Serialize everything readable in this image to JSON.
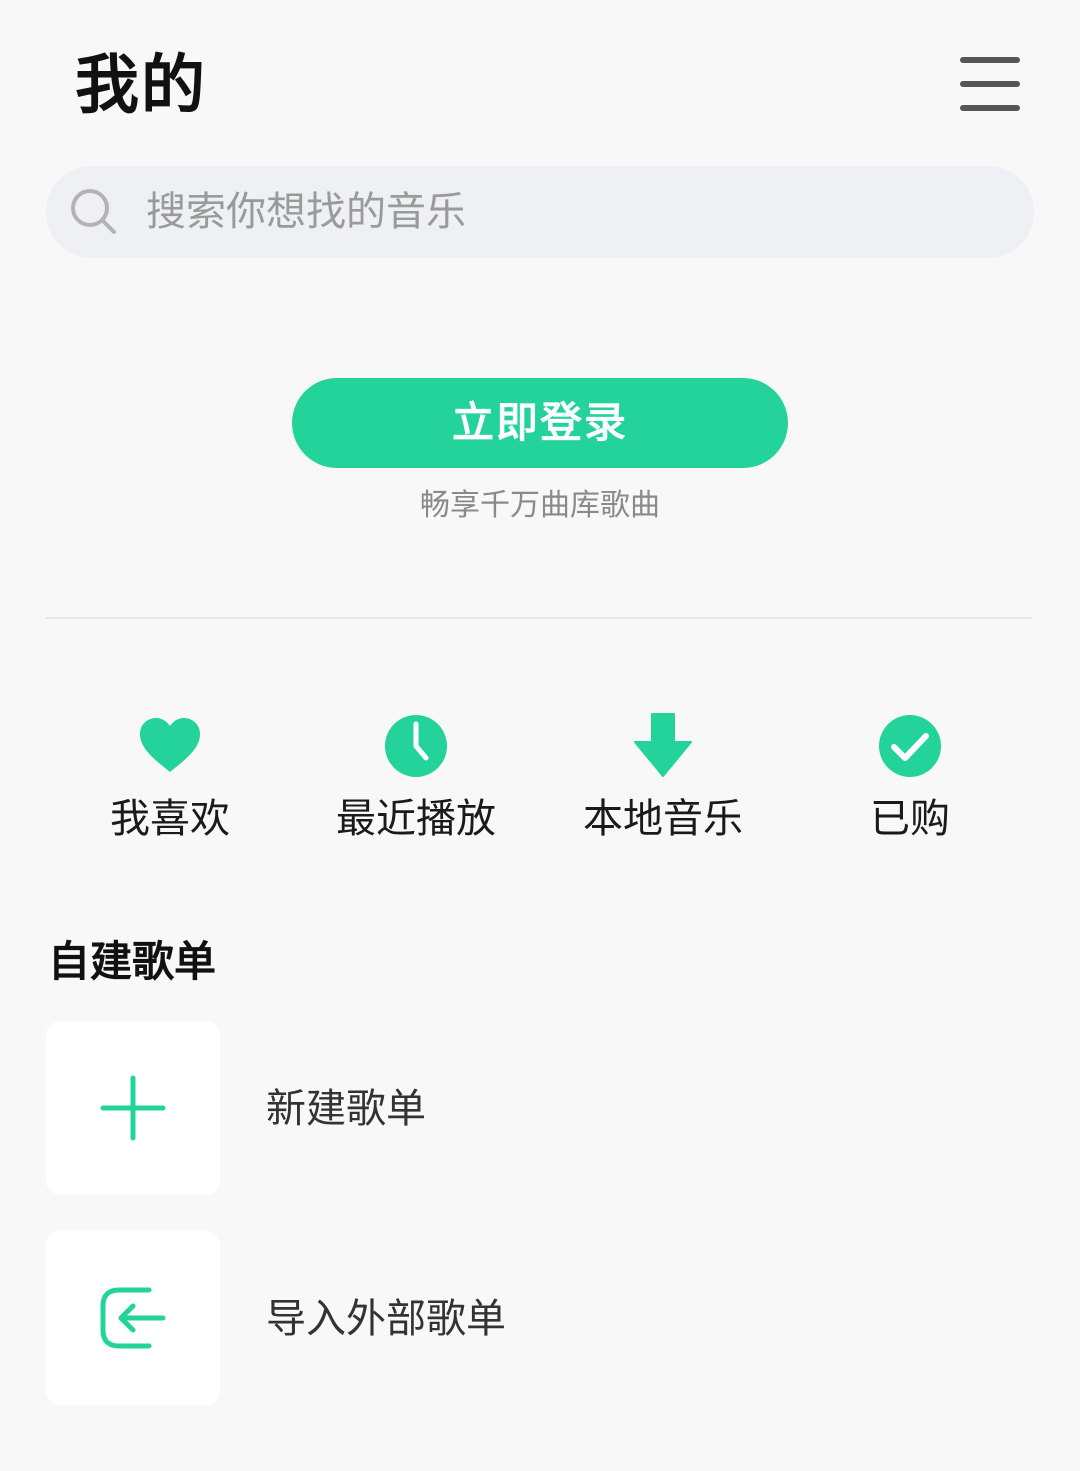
{
  "header": {
    "title": "我的",
    "menu_icon": "hamburger-menu-icon"
  },
  "search": {
    "placeholder": "搜索你想找的音乐",
    "icon": "search-icon"
  },
  "login": {
    "button_label": "立即登录",
    "subtitle": "畅享千万曲库歌曲"
  },
  "quick_actions": [
    {
      "label": "我喜欢",
      "icon": "heart-icon"
    },
    {
      "label": "最近播放",
      "icon": "clock-icon"
    },
    {
      "label": "本地音乐",
      "icon": "download-arrow-icon"
    },
    {
      "label": "已购",
      "icon": "check-circle-icon"
    }
  ],
  "playlists": {
    "section_title": "自建歌单",
    "items": [
      {
        "label": "新建歌单",
        "icon": "plus-icon"
      },
      {
        "label": "导入外部歌单",
        "icon": "import-icon"
      }
    ]
  },
  "colors": {
    "accent": "#24d39a",
    "background": "#f8f8f8",
    "search_bg": "#eef0f3"
  }
}
